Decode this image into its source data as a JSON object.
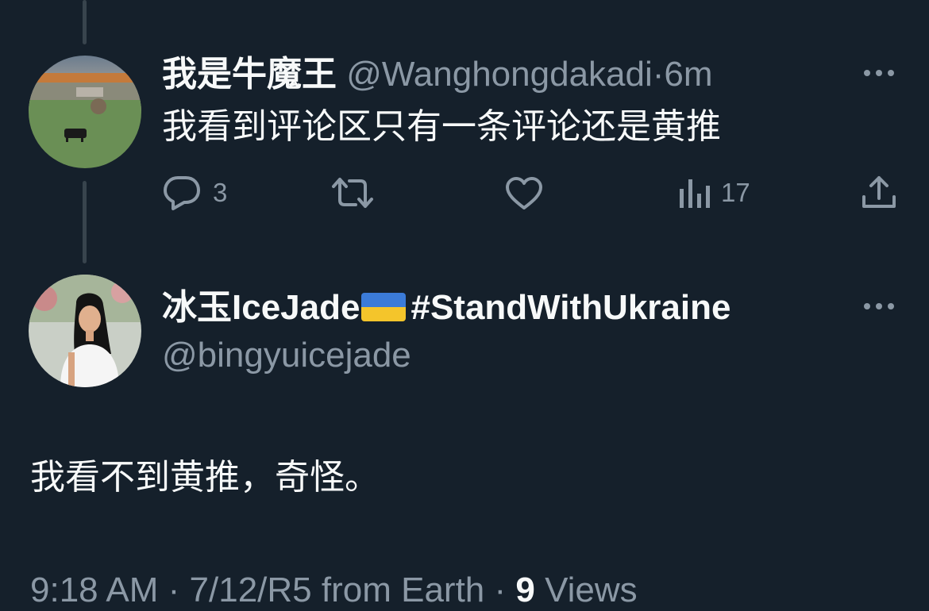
{
  "reply_tweet": {
    "author_name": "我是牛魔王",
    "handle": "@Wanghongdakadi",
    "separator": "·",
    "time": "6m",
    "text": "我看到评论区只有一条评论还是黄推",
    "actions": {
      "reply_count": "3",
      "retweet_count": "",
      "like_count": "",
      "views_count": "17"
    }
  },
  "main_tweet": {
    "author_name": "冰玉IceJade",
    "hashtag": "#StandWithUkraine",
    "handle": "@bingyuicejade",
    "text": "我看不到黄推，奇怪。",
    "footer": {
      "time": "9:18 AM",
      "sep1": " · ",
      "date": "7/12/R5",
      "source": " from Earth",
      "sep2": " · ",
      "views_count": "9",
      "views_label": " Views"
    }
  },
  "colors": {
    "background": "#15202b",
    "text_primary": "#f7f9f9",
    "text_secondary": "#8b98a5",
    "thread_line": "#38444d"
  }
}
